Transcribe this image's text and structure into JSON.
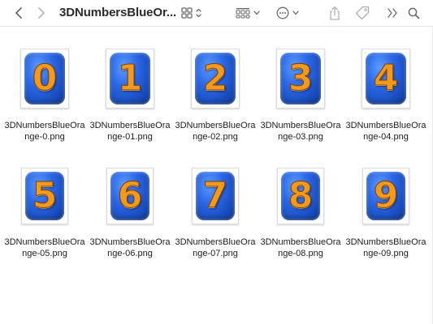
{
  "window": {
    "title": "3DNumbersBlueOr..."
  },
  "toolbar": {
    "back_icon": "chevron-left-icon",
    "forward_icon": "chevron-right-icon",
    "view_icon": "grid-view-icon",
    "group_icon": "group-by-icon",
    "action_icon": "ellipsis-circle-icon",
    "share_icon": "share-icon",
    "tag_icon": "tag-icon",
    "more_icon": "double-chevron-icon",
    "search_icon": "search-icon"
  },
  "colors": {
    "accent": "#1f5fd6",
    "digit": "#f39a1c"
  },
  "files": [
    {
      "digit": "0",
      "name_line1": "3DNumbersBlueOra",
      "name_line2": "nge-0.png"
    },
    {
      "digit": "1",
      "name_line1": "3DNumbersBlueOra",
      "name_line2": "nge-01.png"
    },
    {
      "digit": "2",
      "name_line1": "3DNumbersBlueOra",
      "name_line2": "nge-02.png"
    },
    {
      "digit": "3",
      "name_line1": "3DNumbersBlueOra",
      "name_line2": "nge-03.png"
    },
    {
      "digit": "4",
      "name_line1": "3DNumbersBlueOra",
      "name_line2": "nge-04.png"
    },
    {
      "digit": "5",
      "name_line1": "3DNumbersBlueOra",
      "name_line2": "nge-05.png"
    },
    {
      "digit": "6",
      "name_line1": "3DNumbersBlueOra",
      "name_line2": "nge-06.png"
    },
    {
      "digit": "7",
      "name_line1": "3DNumbersBlueOra",
      "name_line2": "nge-07.png"
    },
    {
      "digit": "8",
      "name_line1": "3DNumbersBlueOra",
      "name_line2": "nge-08.png"
    },
    {
      "digit": "9",
      "name_line1": "3DNumbersBlueOra",
      "name_line2": "nge-09.png"
    }
  ]
}
